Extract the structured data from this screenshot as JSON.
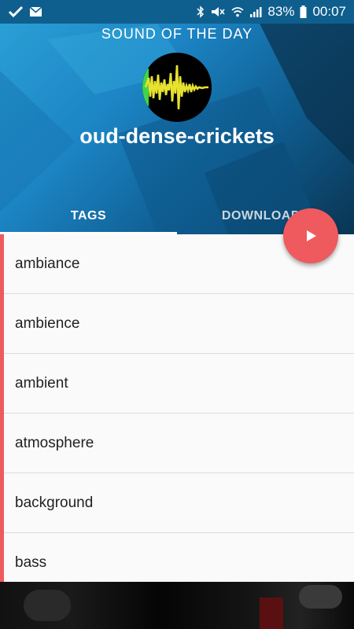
{
  "status_bar": {
    "battery_percent": "83%",
    "time": "00:07",
    "icons": [
      "app-check-icon",
      "email-icon",
      "bluetooth-icon",
      "mute-icon",
      "wifi-icon",
      "signal-icon",
      "battery-icon"
    ]
  },
  "header": {
    "title": "SOUND OF THE DAY",
    "sound_name": "oud-dense-crickets",
    "avatar": "waveform-avatar-icon"
  },
  "tabs": [
    {
      "label": "TAGS",
      "active": true
    },
    {
      "label": "DOWNLOADS",
      "active": false
    }
  ],
  "fab": {
    "icon": "play-icon",
    "color": "#ef5a5f"
  },
  "tags": [
    "ambiance",
    "ambience",
    "ambient",
    "atmosphere",
    "background",
    "bass"
  ],
  "colors": {
    "accent": "#ef5a5f",
    "header_dark": "#0a3553",
    "header_light": "#2a9fd6"
  }
}
